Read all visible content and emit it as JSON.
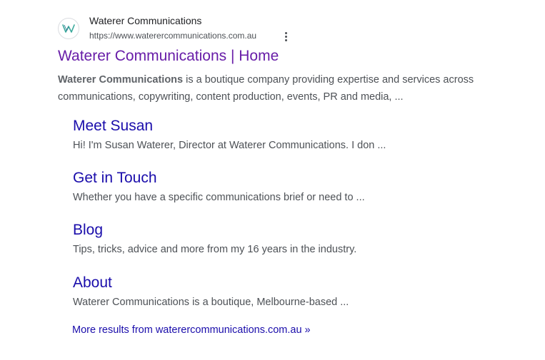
{
  "result": {
    "favicon_icon": "waterer-w-logo-icon",
    "site_name": "Waterer Communications",
    "site_url": "https://www.waterercommunications.com.au",
    "more_options_icon": "three-dot-vertical-icon",
    "title": "Waterer Communications | Home",
    "snippet_bold": "Waterer Communications",
    "snippet_rest": " is a boutique company providing expertise and services across communications, copywriting, content production, events, PR and media, ...",
    "colors": {
      "visited_link": "#681da8",
      "link": "#1a0dab",
      "text": "#4d5156",
      "logo": "#3aa89b"
    }
  },
  "sitelinks": [
    {
      "title": "Meet Susan",
      "description": "Hi! I'm Susan Waterer, Director at Waterer Communications. I don ..."
    },
    {
      "title": "Get in Touch",
      "description": "Whether you have a specific communications brief or need to ..."
    },
    {
      "title": "Blog",
      "description": "Tips, tricks, advice and more from my 16 years in the industry."
    },
    {
      "title": "About",
      "description": "Waterer Communications is a boutique, Melbourne-based ..."
    }
  ],
  "more_results": "More results from waterercommunications.com.au »"
}
